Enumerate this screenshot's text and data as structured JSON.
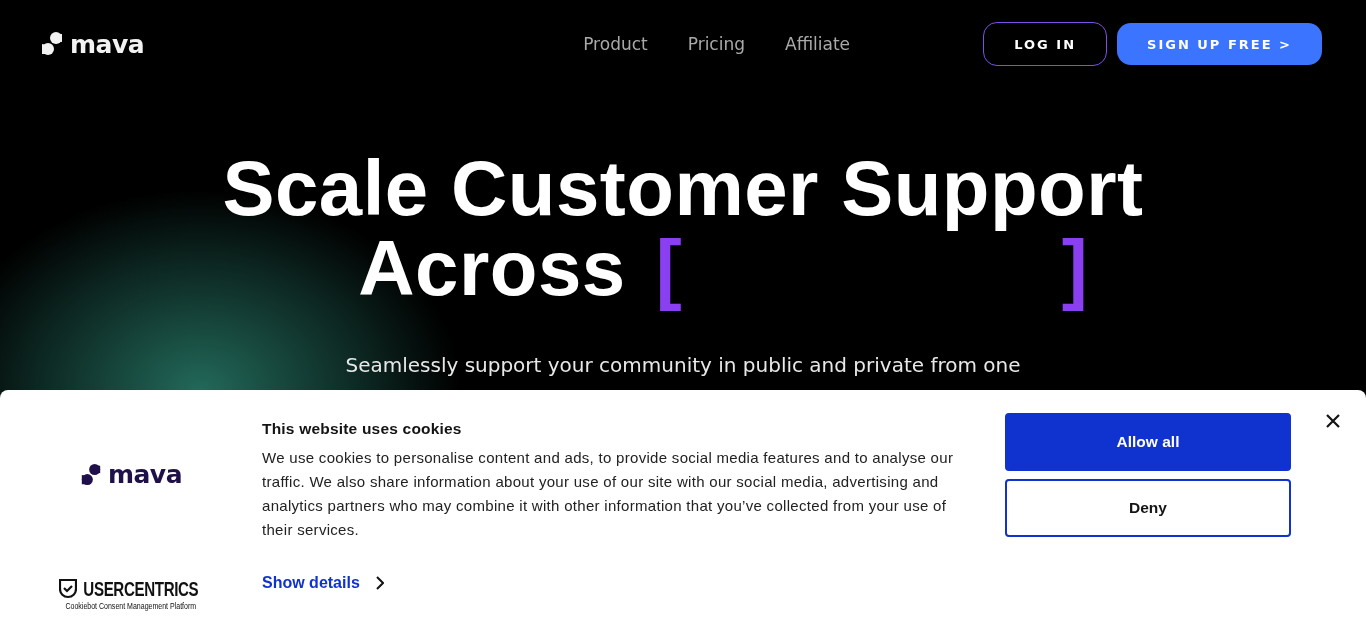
{
  "header": {
    "logo": "mava",
    "nav": [
      {
        "label": "Product"
      },
      {
        "label": "Pricing"
      },
      {
        "label": "Affiliate"
      }
    ],
    "login": "LOG IN",
    "signup": "SIGN UP FREE >"
  },
  "hero": {
    "title_line_1": "Scale Customer Support",
    "title_line_2": "Across",
    "bracket_open": "[",
    "bracket_close": "]",
    "subtitle": "Seamlessly support your community in public and private from one"
  },
  "cookie_banner": {
    "logo": "mava",
    "provider": "USERCENTRICS",
    "provider_tagline": "Cookiebot Consent Management Platform",
    "title": "This website uses cookies",
    "body": "We use cookies to personalise content and ads, to provide social media features and to analyse our traffic. We also share information about your use of our site with our social media, advertising and analytics partners who may combine it with other information that you’ve collected from your use of their services.",
    "show_details": "Show details",
    "allow_all": "Allow all",
    "deny": "Deny"
  }
}
